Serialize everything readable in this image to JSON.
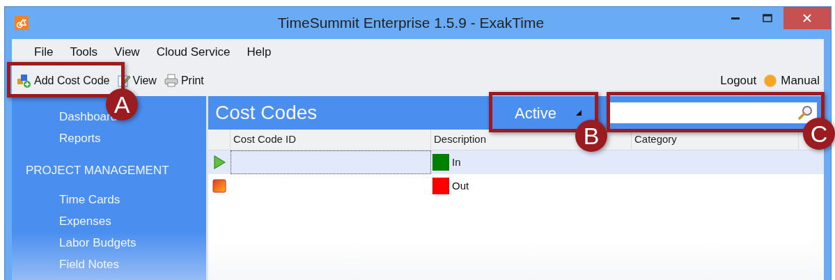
{
  "window": {
    "title": "TimeSummit Enterprise 1.5.9 - ExakTime"
  },
  "menu": [
    "File",
    "Tools",
    "View",
    "Cloud Service",
    "Help"
  ],
  "toolbar": {
    "left": [
      {
        "kind": "add",
        "label": "Add Cost Code"
      },
      {
        "kind": "edit",
        "label": "View"
      },
      {
        "kind": "print",
        "label": "Print"
      }
    ],
    "right": [
      {
        "kind": "link",
        "label": "Logout"
      },
      {
        "kind": "help",
        "label": "Manual"
      }
    ]
  },
  "sidebar": [
    {
      "kind": "item",
      "label": "Dashboard"
    },
    {
      "kind": "item",
      "label": "Reports"
    },
    {
      "kind": "header",
      "label": "PROJECT MANAGEMENT"
    },
    {
      "kind": "item",
      "label": "Time Cards"
    },
    {
      "kind": "item",
      "label": "Expenses"
    },
    {
      "kind": "item",
      "label": "Labor Budgets"
    },
    {
      "kind": "item",
      "label": "Field Notes"
    }
  ],
  "page": {
    "title": "Cost Codes",
    "filter": "Active"
  },
  "table": {
    "columns": [
      "Cost Code ID",
      "Description",
      "Category"
    ],
    "rows": [
      {
        "kind": "play",
        "selected": true,
        "description": "In",
        "color": "#008000"
      },
      {
        "kind": "stop",
        "selected": false,
        "description": "Out",
        "color": "#ff0000"
      }
    ]
  },
  "callouts": [
    "A",
    "B",
    "C"
  ]
}
